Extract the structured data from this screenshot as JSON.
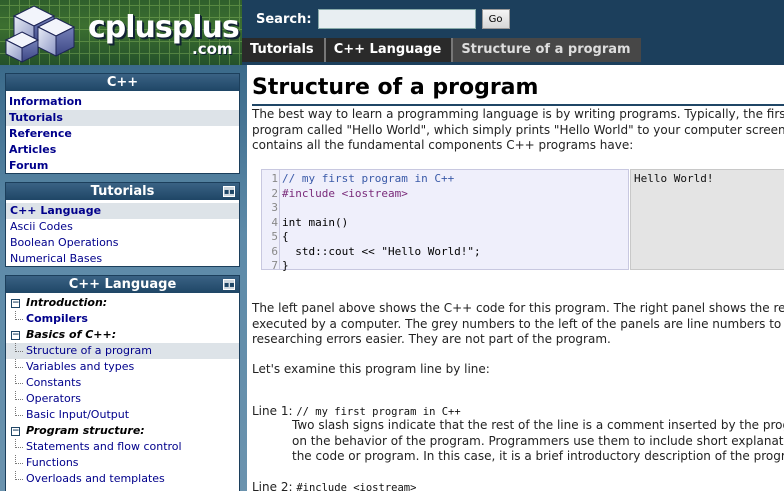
{
  "logo": {
    "name": "cplusplus",
    "tld": ".com"
  },
  "search": {
    "label": "Search:",
    "value": "",
    "button": "Go"
  },
  "breadcrumb": [
    "Tutorials",
    "C++ Language",
    "Structure of a program"
  ],
  "sidebar": {
    "cpp": {
      "title": "C++",
      "items": [
        "Information",
        "Tutorials",
        "Reference",
        "Articles",
        "Forum"
      ]
    },
    "tutorials": {
      "title": "Tutorials",
      "items": [
        "C++ Language",
        "Ascii Codes",
        "Boolean Operations",
        "Numerical Bases"
      ]
    },
    "language": {
      "title": "C++ Language",
      "items": [
        {
          "label": "Introduction:",
          "kind": "section"
        },
        {
          "label": "Compilers",
          "kind": "bold"
        },
        {
          "label": "Basics of C++:",
          "kind": "section"
        },
        {
          "label": "Structure of a program",
          "kind": "selected"
        },
        {
          "label": "Variables and types",
          "kind": "leaf"
        },
        {
          "label": "Constants",
          "kind": "leaf"
        },
        {
          "label": "Operators",
          "kind": "leaf"
        },
        {
          "label": "Basic Input/Output",
          "kind": "leaf"
        },
        {
          "label": "Program structure:",
          "kind": "section"
        },
        {
          "label": "Statements and flow control",
          "kind": "leaf"
        },
        {
          "label": "Functions",
          "kind": "leaf"
        },
        {
          "label": "Overloads and templates",
          "kind": "leaf"
        }
      ]
    },
    "toggle_icon": "collapse-icon"
  },
  "content": {
    "title": "Structure of a program",
    "intro": [
      "The best way to learn a programming language is by writing programs. Typically, the first",
      "program called \"Hello World\", which simply prints \"Hello World\" to your computer screen.",
      "contains all the fundamental components C++ programs have:"
    ],
    "code": {
      "line_numbers": [
        "1",
        "2",
        "3",
        "4",
        "5",
        "6",
        "7"
      ],
      "lines": [
        "// my first program in C++",
        "#include <iostream>",
        "",
        "int main()",
        "{",
        "  std::cout << \"Hello World!\";",
        "}"
      ],
      "output": "Hello World!"
    },
    "explain": [
      "The left panel above shows the C++ code for this program. The right panel shows the res",
      "executed by a computer. The grey numbers to the left of the panels are line numbers to m",
      "researching errors easier. They are not part of the program."
    ],
    "examine": "Let's examine this program line by line:",
    "line1": {
      "label": "Line 1:",
      "code": "// my first program in C++",
      "text": [
        "Two slash signs indicate that the rest of the line is a comment inserted by the prog",
        "on the behavior of the program. Programmers use them to include short explanati",
        "the code or program. In this case, it is a brief introductory description of the progra"
      ]
    },
    "line2": {
      "label": "Line 2:",
      "code": "#include <iostream>"
    }
  }
}
